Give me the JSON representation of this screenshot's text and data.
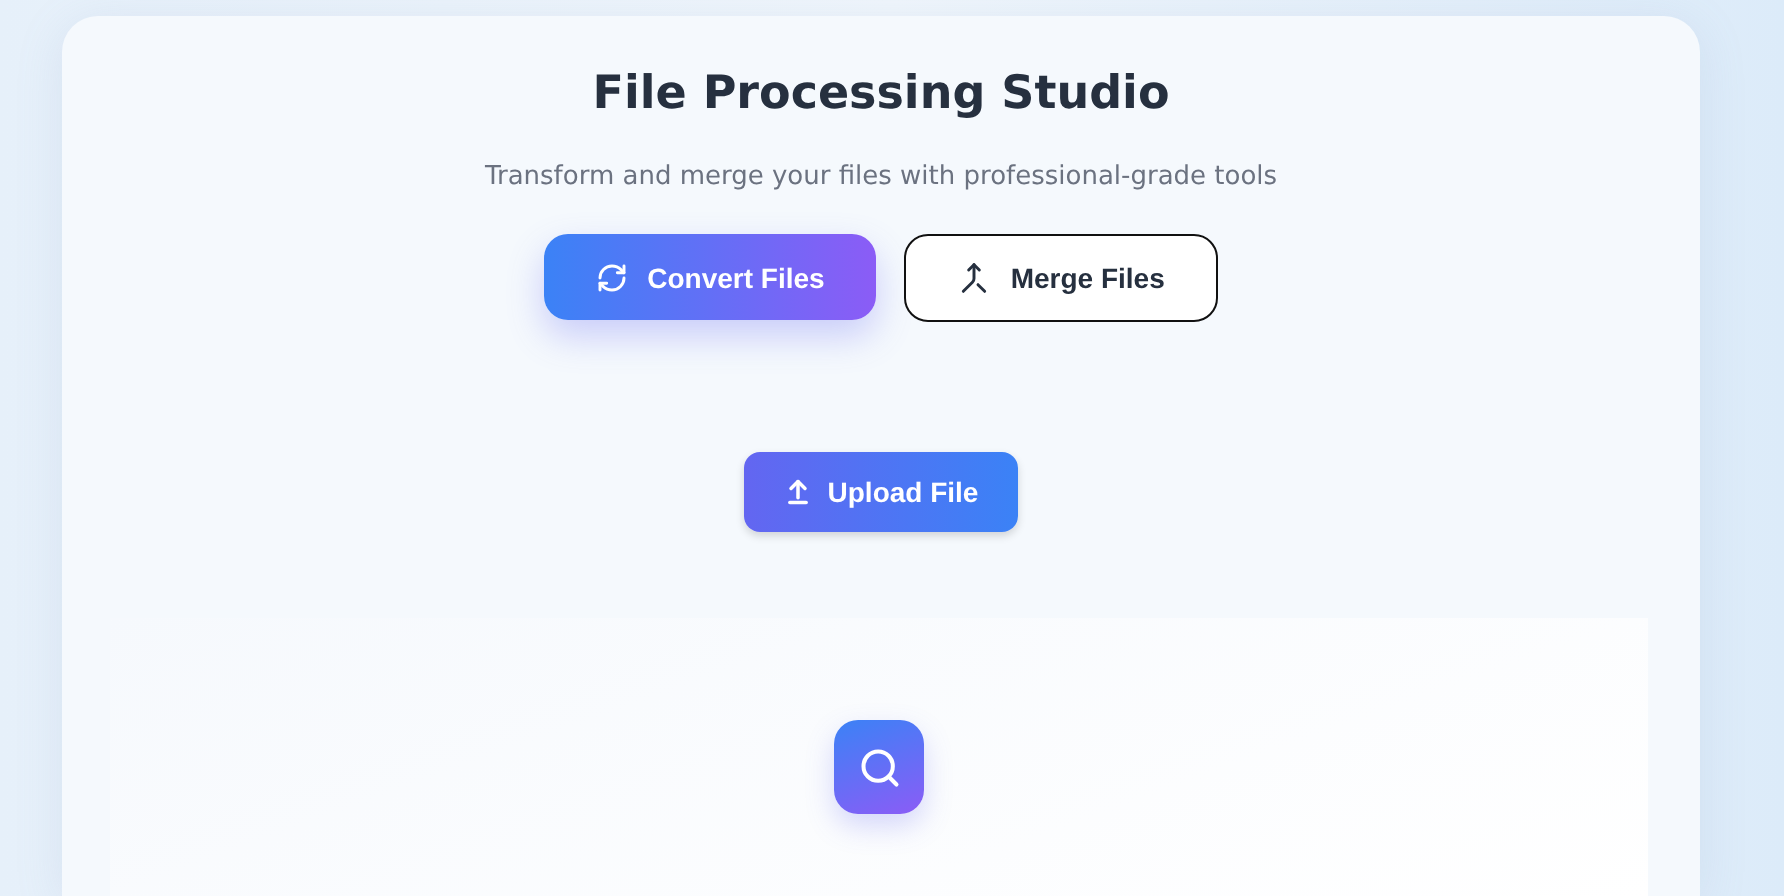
{
  "title": "File Processing Studio",
  "subtitle": "Transform and merge your files with professional-grade tools",
  "tabs": [
    {
      "label": "Convert Files",
      "kind": "convert",
      "selected": true
    },
    {
      "label": "Merge Files",
      "kind": "merge",
      "selected": false
    }
  ],
  "upload_button": {
    "label": "Upload File"
  }
}
